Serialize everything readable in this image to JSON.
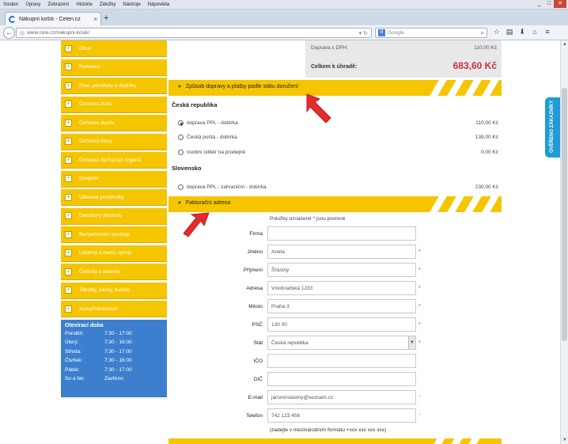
{
  "browser": {
    "menu": [
      "Soubor",
      "Úpravy",
      "Zobrazení",
      "Historie",
      "Záložky",
      "Nástroje",
      "Nápověda"
    ],
    "tab_title": "Nákupní košík - Celen.cz",
    "new_tab": "+",
    "url": "www.cele.cz/nakupni-kosik/",
    "search_placeholder": "Google",
    "window_controls": [
      "_",
      "□",
      "✕"
    ]
  },
  "sidebar": {
    "categories": [
      "Obuv",
      "Rukavice",
      "Prac. pomůcky a doplňky",
      "Ochrana zraku",
      "Ochrana sluchu",
      "Ochrana hlavy",
      "Ochrana dýchacích orgánů",
      "Drogérie",
      "Úklidové prostředky",
      "Detektory alkoholu",
      "Bezpečnostní postroje",
      "Lékárny a hasicí spreje",
      "Čelovky a baterky",
      "Tabulky, pásky, kužele",
      "Autopříslušenství"
    ],
    "hours": {
      "title": "Otevírací doba",
      "rows": [
        {
          "day": "Pondělí:",
          "time": "7:30 - 17:00"
        },
        {
          "day": "Úterý:",
          "time": "7:30 - 16:00"
        },
        {
          "day": "Středa:",
          "time": "7:30 - 17:00"
        },
        {
          "day": "Čtvrtek:",
          "time": "7:30 - 16:00"
        },
        {
          "day": "Pátek:",
          "time": "7:30 - 17:00"
        },
        {
          "day": "So a Ne:",
          "time": "Zavřeno"
        }
      ]
    }
  },
  "summary": {
    "shipping_label": "Doprava s DPH:",
    "shipping_value": "110,00 Kč",
    "total_label": "Celkem k úhradě:",
    "total_value": "683,60 Kč"
  },
  "shipping": {
    "band_title": "Způsob dopravy a platby podle státu doručení",
    "band_marker": "»",
    "countries": [
      {
        "name": "Česká republika",
        "options": [
          {
            "label": "doprava PPL - dobírka",
            "price": "110,00 Kč",
            "selected": true
          },
          {
            "label": "Česká pošta - dobírka",
            "price": "139,00 Kč",
            "selected": false
          },
          {
            "label": "osobní odběr na prodejně",
            "price": "0,00 Kč",
            "selected": false
          }
        ]
      },
      {
        "name": "Slovensko",
        "options": [
          {
            "label": "doprava PPL - zahraniční - dobírka",
            "price": "230,00 Kč",
            "selected": false
          }
        ]
      }
    ]
  },
  "billing": {
    "band_title": "Fakturační adresa",
    "band_marker": "»",
    "required_note": "Položky označené * jsou povinné",
    "fields": [
      {
        "label": "Firma",
        "value": "",
        "required": ""
      },
      {
        "label": "Jméno",
        "value": "Aneta",
        "required": "*"
      },
      {
        "label": "Příjmení",
        "value": "Šťastný",
        "required": "*"
      },
      {
        "label": "Adresa",
        "value": "Vinohradská 1233",
        "required": "*"
      },
      {
        "label": "Město",
        "value": "Praha 3",
        "required": "*"
      },
      {
        "label": "PSČ",
        "value": "130 00",
        "required": "*"
      },
      {
        "label": "Stát",
        "value": "Česká republika",
        "required": "*"
      },
      {
        "label": "IČO",
        "value": "",
        "required": ""
      },
      {
        "label": "DIČ",
        "value": "",
        "required": ""
      },
      {
        "label": "E-mail",
        "value": "jaromirstastny@seznam.cz",
        "required": "*"
      },
      {
        "label": "Telefon",
        "value": "742 123 456",
        "required": "*"
      }
    ],
    "phone_hint": "(zadejte v mezinárodním formátu +xxx xxx xxx xxx)"
  },
  "verified_tab": "OVĚŘENO ZÁKAZNÍKY",
  "colors": {
    "band": "#f5c500",
    "accent_price": "#cf2f3f",
    "hours_bg": "#3c7fce",
    "verified_bg": "#1f9bd8",
    "arrow": "#e52b2b"
  }
}
